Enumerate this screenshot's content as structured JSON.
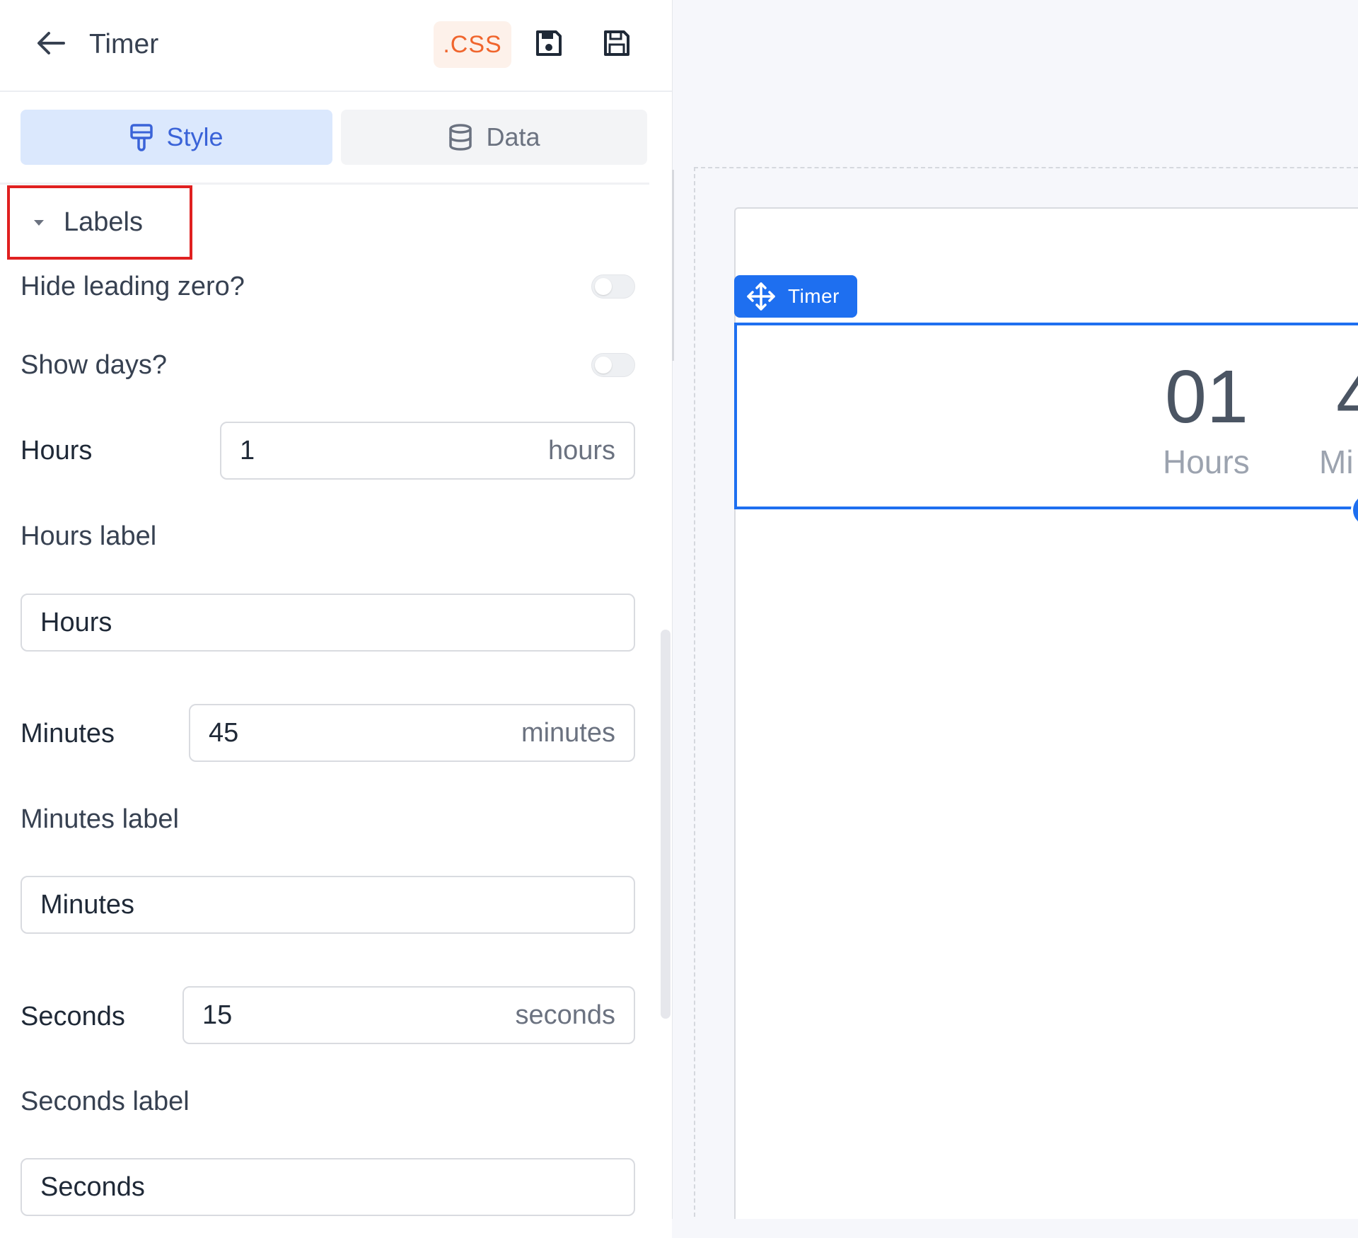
{
  "header": {
    "title": "Timer",
    "css_label": ".CSS"
  },
  "tabs": [
    {
      "label": "Style",
      "active": true
    },
    {
      "label": "Data",
      "active": false
    }
  ],
  "section": {
    "title": "Labels",
    "expanded": true
  },
  "settings": {
    "hide_leading_zero": {
      "label": "Hide leading zero?",
      "on": false
    },
    "show_days": {
      "label": "Show days?",
      "on": false
    },
    "hours": {
      "label": "Hours",
      "value": "1",
      "unit": "hours"
    },
    "hours_label": {
      "label": "Hours label",
      "value": "Hours"
    },
    "minutes": {
      "label": "Minutes",
      "value": "45",
      "unit": "minutes"
    },
    "minutes_label": {
      "label": "Minutes label",
      "value": "Minutes"
    },
    "seconds": {
      "label": "Seconds",
      "value": "15",
      "unit": "seconds"
    },
    "seconds_label": {
      "label": "Seconds label",
      "value": "Seconds"
    }
  },
  "canvas": {
    "component_tag": "Timer",
    "timer": {
      "hours_value": "01",
      "hours_label": "Hours",
      "minutes_value_partial": "4",
      "minutes_label_partial": "Mi"
    }
  },
  "colors": {
    "accent": "#1e6ff0",
    "style_tab_bg": "#dbe8fd",
    "css_orange": "#f0652d",
    "highlight_red": "#e02020"
  }
}
